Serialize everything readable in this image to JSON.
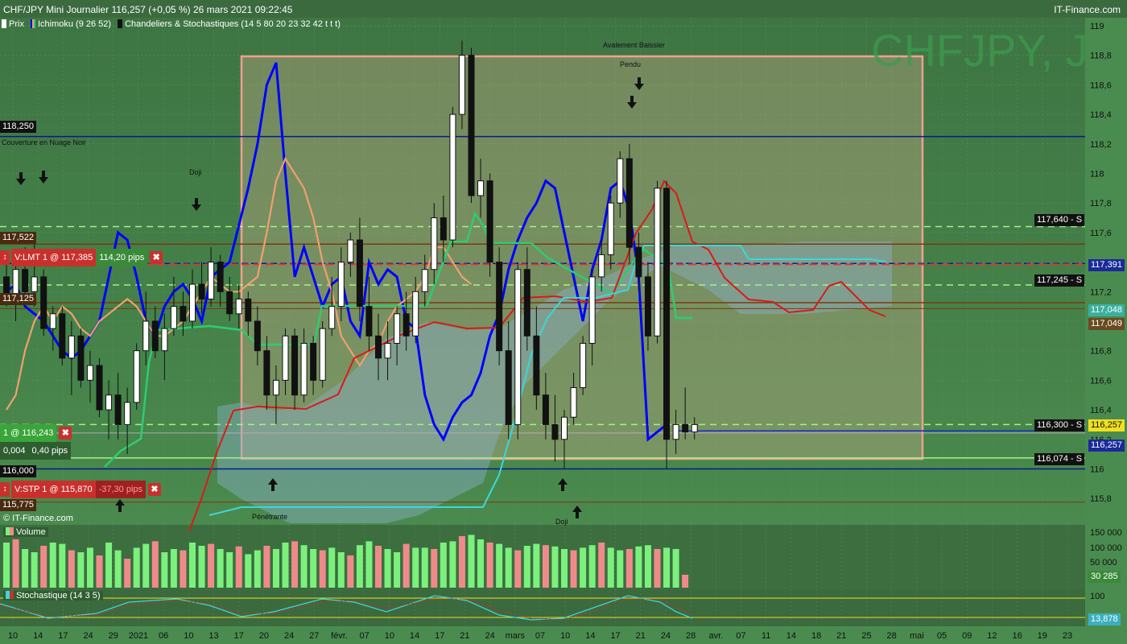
{
  "header": {
    "title": "CHF/JPY Mini Journalier 116,257 (+0,05 %) 26 mars 2021 09:22:45",
    "brand": "IT-Finance.com",
    "watermark": "CHFJPY, J",
    "copyright": "© IT-Finance.com"
  },
  "legend": {
    "prix": "Prix",
    "ichimoku": "Ichimoku (9 26 52)",
    "chandeliers": "Chandeliers & Stochastiques (14 5 80 20 23 32 42 t t t)"
  },
  "colors": {
    "background": "#3d6b3f",
    "tenkan": "#0000ff",
    "kijun": "#f0a070",
    "chikou": "#2ecc71",
    "ssa": "#d91a1a",
    "ssb": "#3ad8d8",
    "rect": "#f0a090",
    "volume_up": "#7cf07c",
    "volume_down": "#f08a8a"
  },
  "orders": {
    "limit_label": "V:LMT  1 @ 117,385",
    "limit_pips": "114,20 pips",
    "position_label": "1 @ 116,243",
    "position_value": "0,004",
    "position_pips": "0,40 pips",
    "stop_label": "V:STP  1 @ 115,870",
    "stop_pips": "-37,30 pips",
    "close_glyph": "✖"
  },
  "price_tags_left": [
    "118,250",
    "117,522",
    "117,125",
    "116,000",
    "115,775"
  ],
  "support_labels": [
    "117,640 - S",
    "117,245 - S",
    "116,300 - S",
    "116,074 - S"
  ],
  "axis_tags_right": {
    "t117391": "117,391",
    "t117049": "117,049",
    "t117048": "117,048",
    "t116257a": "116,257",
    "t116257b": "116,257"
  },
  "annotations": {
    "nuage_noir": "Couverture en Nuage Noir",
    "avalement_top": "Avalement Baissier",
    "doji_top": "Doji",
    "avalement": "Avalement Baissier",
    "pendu": "Pendu",
    "penetrante": "Pénétrante",
    "doji_bottom": "Doji"
  },
  "volume_panel": {
    "title": "Volume",
    "current": "30 285",
    "ticks": [
      "150 000",
      "100 000",
      "50 000"
    ]
  },
  "stoch_panel": {
    "title": "Stochastique (14 3 5)",
    "current": "13,878",
    "ticks": [
      "100"
    ]
  },
  "chart_data": {
    "type": "candlestick",
    "instrument": "CHF/JPY",
    "y_ticks": [
      119,
      118.8,
      118.6,
      118.4,
      118.2,
      118,
      117.8,
      117.6,
      117.4,
      117.2,
      117,
      116.8,
      116.6,
      116.4,
      116.2,
      116,
      115.8
    ],
    "y_tick_labels": [
      "119",
      "118,8",
      "118,6",
      "118,4",
      "118,2",
      "118",
      "117,8",
      "117,6",
      "117,4",
      "117,2",
      "117",
      "116,8",
      "116,6",
      "116,4",
      "116,2",
      "116",
      "115,8"
    ],
    "ylim": [
      115.7,
      119.05
    ],
    "x_ticks": [
      "10",
      "14",
      "17",
      "24",
      "29",
      "2021",
      "06",
      "10",
      "13",
      "17",
      "20",
      "24",
      "27",
      "févr.",
      "07",
      "10",
      "14",
      "17",
      "21",
      "24",
      "mars",
      "07",
      "10",
      "14",
      "17",
      "21",
      "24",
      "28",
      "avr.",
      "07",
      "11",
      "14",
      "18",
      "21",
      "25",
      "28",
      "mai",
      "05",
      "09",
      "12",
      "16",
      "19",
      "23"
    ],
    "candles": [
      [
        117.3,
        117.45,
        117.1,
        117.15
      ],
      [
        117.15,
        117.4,
        117.0,
        117.35
      ],
      [
        117.35,
        117.5,
        117.1,
        117.2
      ],
      [
        117.2,
        117.6,
        117.1,
        117.3
      ],
      [
        117.3,
        117.35,
        116.9,
        116.95
      ],
      [
        116.95,
        117.1,
        116.8,
        117.05
      ],
      [
        117.05,
        117.1,
        116.7,
        116.75
      ],
      [
        116.75,
        117.0,
        116.5,
        116.9
      ],
      [
        116.9,
        116.95,
        116.55,
        116.6
      ],
      [
        116.6,
        116.8,
        116.45,
        116.7
      ],
      [
        116.7,
        116.75,
        116.35,
        116.4
      ],
      [
        116.4,
        116.6,
        116.2,
        116.5
      ],
      [
        116.5,
        116.65,
        116.2,
        116.3
      ],
      [
        116.3,
        116.55,
        116.1,
        116.45
      ],
      [
        116.45,
        116.85,
        116.4,
        116.8
      ],
      [
        116.8,
        117.2,
        116.7,
        117.0
      ],
      [
        117.0,
        117.1,
        116.75,
        116.8
      ],
      [
        116.8,
        117.05,
        116.6,
        116.95
      ],
      [
        116.95,
        117.3,
        116.9,
        117.1
      ],
      [
        117.1,
        117.2,
        116.9,
        117.0
      ],
      [
        117.0,
        117.35,
        116.95,
        117.25
      ],
      [
        117.25,
        117.4,
        117.05,
        117.15
      ],
      [
        117.15,
        117.5,
        117.1,
        117.4
      ],
      [
        117.4,
        117.45,
        117.1,
        117.2
      ],
      [
        117.2,
        117.3,
        117.0,
        117.05
      ],
      [
        117.05,
        117.25,
        116.95,
        117.15
      ],
      [
        117.15,
        117.2,
        116.9,
        117.0
      ],
      [
        117.0,
        117.1,
        116.7,
        116.8
      ],
      [
        116.8,
        116.9,
        116.4,
        116.5
      ],
      [
        116.5,
        116.7,
        116.3,
        116.6
      ],
      [
        116.6,
        116.95,
        116.5,
        116.9
      ],
      [
        116.9,
        116.95,
        116.4,
        116.5
      ],
      [
        116.5,
        116.95,
        116.45,
        116.85
      ],
      [
        116.85,
        116.9,
        116.5,
        116.6
      ],
      [
        116.6,
        117.0,
        116.55,
        116.95
      ],
      [
        116.95,
        117.3,
        116.9,
        117.1
      ],
      [
        117.1,
        117.5,
        117.0,
        117.4
      ],
      [
        117.4,
        117.6,
        117.3,
        117.55
      ],
      [
        117.55,
        117.7,
        117.0,
        117.1
      ],
      [
        117.1,
        117.3,
        116.8,
        116.9
      ],
      [
        116.9,
        117.05,
        116.6,
        116.75
      ],
      [
        116.75,
        117.0,
        116.6,
        116.85
      ],
      [
        116.85,
        117.1,
        116.7,
        117.05
      ],
      [
        117.05,
        117.2,
        116.8,
        116.9
      ],
      [
        116.9,
        117.3,
        116.85,
        117.2
      ],
      [
        117.2,
        117.45,
        117.1,
        117.35
      ],
      [
        117.35,
        117.8,
        117.25,
        117.7
      ],
      [
        117.7,
        117.85,
        117.4,
        117.55
      ],
      [
        117.55,
        118.45,
        117.5,
        118.4
      ],
      [
        118.4,
        118.9,
        118.3,
        118.8
      ],
      [
        118.8,
        118.85,
        117.8,
        117.85
      ],
      [
        117.85,
        118.1,
        117.7,
        117.95
      ],
      [
        117.95,
        118.0,
        117.3,
        117.4
      ],
      [
        117.4,
        117.5,
        116.7,
        116.8
      ],
      [
        116.8,
        117.0,
        116.2,
        116.3
      ],
      [
        116.3,
        117.4,
        116.2,
        117.35
      ],
      [
        117.35,
        117.5,
        116.8,
        116.9
      ],
      [
        116.9,
        117.1,
        116.4,
        116.5
      ],
      [
        116.5,
        116.65,
        116.2,
        116.3
      ],
      [
        116.3,
        116.5,
        116.05,
        116.2
      ],
      [
        116.2,
        116.4,
        116.0,
        116.35
      ],
      [
        116.35,
        116.65,
        116.3,
        116.55
      ],
      [
        116.55,
        116.9,
        116.5,
        116.85
      ],
      [
        116.85,
        117.35,
        116.7,
        117.3
      ],
      [
        117.3,
        117.55,
        117.2,
        117.45
      ],
      [
        117.45,
        117.85,
        117.35,
        117.8
      ],
      [
        117.8,
        118.15,
        117.7,
        118.1
      ],
      [
        118.1,
        118.2,
        117.4,
        117.5
      ],
      [
        117.5,
        117.6,
        117.2,
        117.3
      ],
      [
        117.3,
        117.4,
        116.8,
        116.9
      ],
      [
        116.9,
        117.95,
        116.85,
        117.9
      ],
      [
        117.9,
        117.95,
        116.0,
        116.2
      ],
      [
        116.2,
        116.4,
        116.1,
        116.3
      ],
      [
        116.3,
        116.55,
        116.2,
        116.25
      ],
      [
        116.25,
        116.35,
        116.2,
        116.3
      ]
    ],
    "tenkan": [
      117.2,
      117.25,
      117.1,
      117.05,
      117.0,
      116.9,
      116.8,
      116.75,
      116.8,
      116.9,
      117.0,
      117.3,
      117.6,
      117.55,
      117.3,
      117.0,
      116.9,
      117.1,
      117.2,
      117.25,
      117.15,
      117.0,
      117.3,
      117.35,
      117.4,
      117.65,
      117.9,
      118.2,
      118.6,
      118.75,
      118.0,
      117.3,
      117.5,
      117.3,
      117.1,
      117.25,
      117.3,
      117.0,
      116.9,
      117.4,
      117.25,
      117.35,
      117.3,
      117.0,
      116.95,
      116.5,
      116.3,
      116.2,
      116.35,
      116.45,
      116.5,
      116.65,
      116.9,
      117.05,
      117.35,
      117.55,
      117.7,
      117.8,
      117.95,
      117.9,
      117.6,
      117.3,
      117.0,
      117.35,
      117.55,
      117.9,
      117.95,
      117.75,
      117.3,
      116.2,
      116.25,
      116.3
    ],
    "kijun": [
      116.4,
      116.5,
      116.8,
      117.0,
      117.1,
      117.0,
      117.1,
      117.05,
      116.95,
      116.9,
      117.0,
      117.05,
      117.1,
      117.15,
      117.1,
      117.0,
      116.9,
      116.9,
      116.95,
      117.0,
      117.1,
      117.2,
      117.3,
      117.25,
      117.2,
      117.2,
      117.25,
      117.3,
      117.6,
      117.95,
      118.1,
      118.0,
      117.9,
      117.7,
      117.4,
      117.2,
      116.9,
      116.8,
      116.7,
      116.8,
      116.85,
      117.0,
      117.1,
      117.15,
      117.2,
      117.3,
      117.5,
      117.5,
      117.4,
      117.3,
      117.25
    ]
  }
}
